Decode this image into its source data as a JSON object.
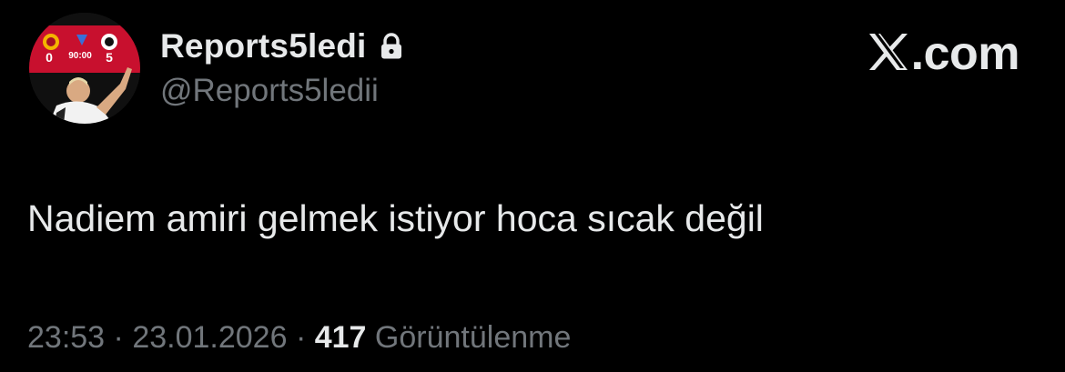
{
  "author": {
    "display_name": "Reports5ledi",
    "handle": "@Reports5ledii",
    "protected_icon": "lock-icon",
    "avatar": {
      "scoreboard_time": "90:00",
      "home_score": "0",
      "away_score": "5"
    }
  },
  "brand": {
    "logo_icon": "x-logo-icon",
    "label": ".com"
  },
  "tweet": {
    "text": "Nadiem amiri gelmek istiyor hoca sıcak değil"
  },
  "meta": {
    "time": "23:53",
    "separator": "·",
    "date": "23.01.2026",
    "views_count": "417",
    "views_label": "Görüntülenme"
  },
  "colors": {
    "background": "#000000",
    "primary_text": "#e7e9ea",
    "secondary_text": "#71767b",
    "scoreboard_red": "#c8102e"
  }
}
